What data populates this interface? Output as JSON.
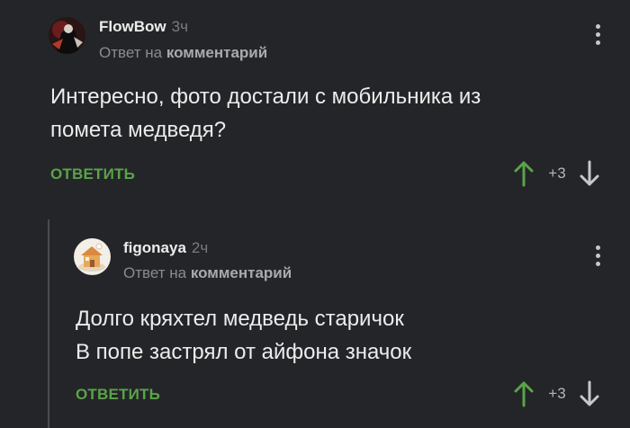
{
  "colors": {
    "background": "#242528",
    "accent_green": "#5aa34a",
    "text": "#ececec",
    "muted": "#8a8b90"
  },
  "comments": [
    {
      "author": "FlowBow",
      "time": "3ч",
      "reply_prefix": "Ответ на",
      "reply_target": "комментарий",
      "text": "Интересно, фото достали с мобильника из\nпомета медведя?",
      "reply_label": "ОТВЕТИТЬ",
      "score": "+3",
      "avatar_icon": "dark-figure-avatar"
    },
    {
      "author": "figonaya",
      "time": "2ч",
      "reply_prefix": "Ответ на",
      "reply_target": "комментарий",
      "text": "Долго кряхтел медведь старичок\nВ попе застрял от айфона значок",
      "reply_label": "ОТВЕТИТЬ",
      "score": "+3",
      "avatar_icon": "cartoon-house-avatar"
    }
  ]
}
